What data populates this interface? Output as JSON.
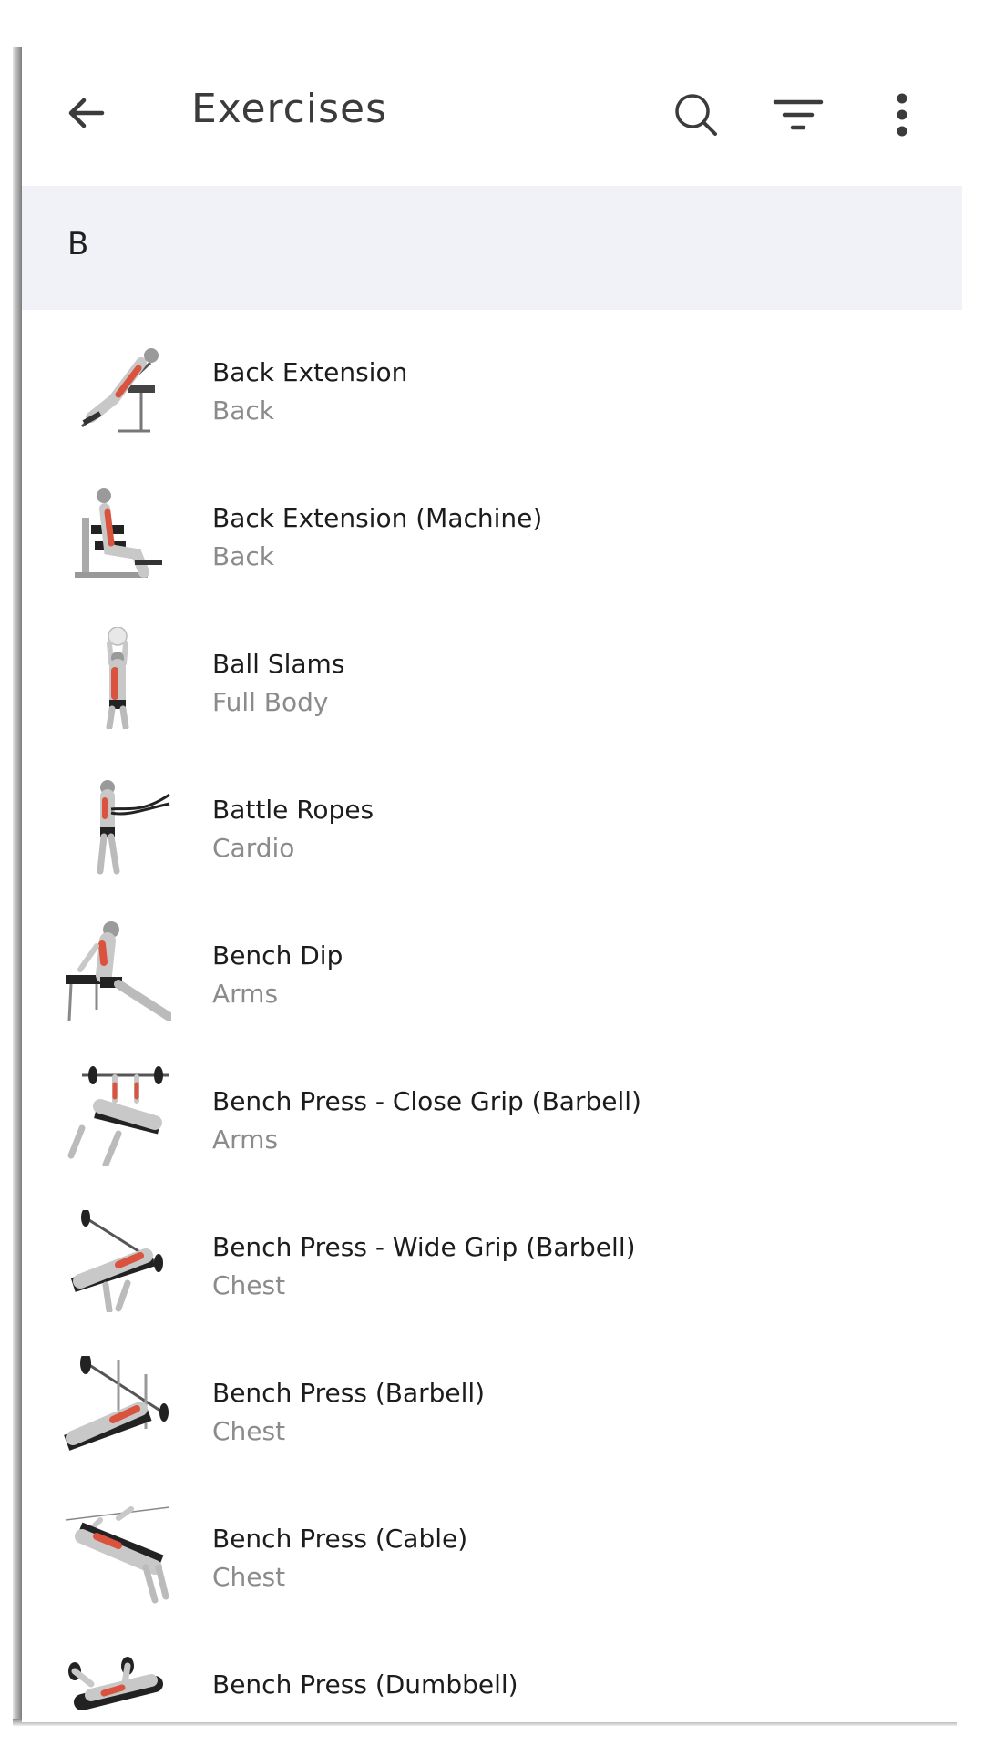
{
  "appbar": {
    "title": "Exercises",
    "back_icon": "arrow-left-icon",
    "search_icon": "search-icon",
    "filter_icon": "filter-icon",
    "more_icon": "more-vert-icon"
  },
  "section": {
    "letter": "B"
  },
  "colors": {
    "section_bg": "#f0f2f7",
    "muscle_highlight": "#d9533f",
    "body_gray": "#bdbdbd"
  },
  "exercises": [
    {
      "name": "Back Extension",
      "category": "Back"
    },
    {
      "name": "Back Extension (Machine)",
      "category": "Back"
    },
    {
      "name": "Ball Slams",
      "category": "Full Body"
    },
    {
      "name": "Battle Ropes",
      "category": "Cardio"
    },
    {
      "name": "Bench Dip",
      "category": "Arms"
    },
    {
      "name": "Bench Press - Close Grip (Barbell)",
      "category": "Arms"
    },
    {
      "name": "Bench Press - Wide Grip (Barbell)",
      "category": "Chest"
    },
    {
      "name": "Bench Press (Barbell)",
      "category": "Chest"
    },
    {
      "name": "Bench Press (Cable)",
      "category": "Chest"
    },
    {
      "name": "Bench Press (Dumbbell)",
      "category": ""
    }
  ]
}
